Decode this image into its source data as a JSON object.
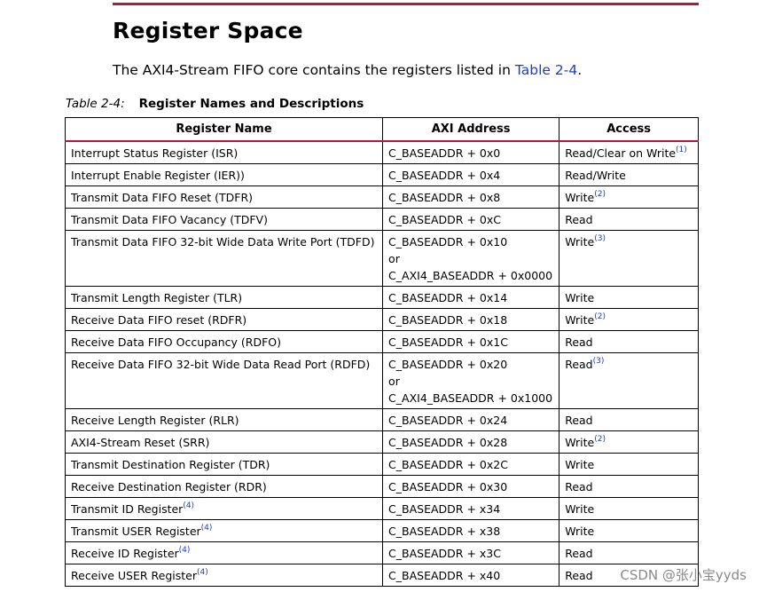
{
  "section": {
    "title": "Register Space",
    "intro_text": "The AXI4-Stream FIFO core contains the registers listed in ",
    "intro_link": "Table 2-4",
    "intro_end": "."
  },
  "table": {
    "caption_label": "Table 2-4:",
    "caption_title": "Register Names and Descriptions",
    "headers": [
      "Register Name",
      "AXI Address",
      "Access"
    ],
    "rows": [
      {
        "name": "Interrupt Status Register (ISR)",
        "name_fn": "",
        "address": [
          "C_BASEADDR + 0x0"
        ],
        "access": "Read/Clear on Write",
        "access_fn": "(1)"
      },
      {
        "name": "Interrupt Enable Register (IER))",
        "name_fn": "",
        "address": [
          "C_BASEADDR + 0x4"
        ],
        "access": "Read/Write",
        "access_fn": ""
      },
      {
        "name": "Transmit Data FIFO Reset (TDFR)",
        "name_fn": "",
        "address": [
          "C_BASEADDR + 0x8"
        ],
        "access": "Write",
        "access_fn": "(2)"
      },
      {
        "name": "Transmit Data FIFO Vacancy (TDFV)",
        "name_fn": "",
        "address": [
          "C_BASEADDR + 0xC"
        ],
        "access": "Read",
        "access_fn": ""
      },
      {
        "name": "Transmit Data FIFO 32-bit Wide Data Write Port (TDFD)",
        "name_fn": "",
        "address": [
          "C_BASEADDR + 0x10",
          "or",
          "C_AXI4_BASEADDR + 0x0000"
        ],
        "access": "Write",
        "access_fn": "(3)"
      },
      {
        "name": "Transmit Length Register (TLR)",
        "name_fn": "",
        "address": [
          "C_BASEADDR + 0x14"
        ],
        "access": "Write",
        "access_fn": ""
      },
      {
        "name": "Receive Data FIFO reset (RDFR)",
        "name_fn": "",
        "address": [
          "C_BASEADDR + 0x18"
        ],
        "access": "Write",
        "access_fn": "(2)"
      },
      {
        "name": "Receive Data FIFO Occupancy (RDFO)",
        "name_fn": "",
        "address": [
          "C_BASEADDR + 0x1C"
        ],
        "access": "Read",
        "access_fn": ""
      },
      {
        "name": "Receive Data FIFO 32-bit Wide Data Read Port (RDFD)",
        "name_fn": "",
        "address": [
          "C_BASEADDR + 0x20",
          "or",
          "C_AXI4_BASEADDR + 0x1000"
        ],
        "access": "Read",
        "access_fn": "(3)"
      },
      {
        "name": "Receive Length Register (RLR)",
        "name_fn": "",
        "address": [
          "C_BASEADDR + 0x24"
        ],
        "access": "Read",
        "access_fn": ""
      },
      {
        "name": "AXI4-Stream Reset (SRR)",
        "name_fn": "",
        "address": [
          "C_BASEADDR + 0x28"
        ],
        "access": "Write",
        "access_fn": "(2)"
      },
      {
        "name": "Transmit Destination Register (TDR)",
        "name_fn": "",
        "address": [
          "C_BASEADDR + 0x2C"
        ],
        "access": "Write",
        "access_fn": ""
      },
      {
        "name": "Receive Destination Register (RDR)",
        "name_fn": "",
        "address": [
          "C_BASEADDR + 0x30"
        ],
        "access": "Read",
        "access_fn": ""
      },
      {
        "name": "Transmit ID Register",
        "name_fn": "(4)",
        "address": [
          "C_BASEADDR + x34"
        ],
        "access": "Write",
        "access_fn": ""
      },
      {
        "name": "Transmit USER Register",
        "name_fn": "(4)",
        "address": [
          "C_BASEADDR + x38"
        ],
        "access": "Write",
        "access_fn": ""
      },
      {
        "name": "Receive ID Register",
        "name_fn": "(4)",
        "address": [
          "C_BASEADDR + x3C"
        ],
        "access": "Read",
        "access_fn": ""
      },
      {
        "name": "Receive USER Register",
        "name_fn": "(4)",
        "address": [
          "C_BASEADDR + x40"
        ],
        "access": "Read",
        "access_fn": ""
      }
    ]
  },
  "watermark": "CSDN @张小宝yyds",
  "colors": {
    "rule": "#b2183d",
    "link": "#1a3ccc"
  }
}
